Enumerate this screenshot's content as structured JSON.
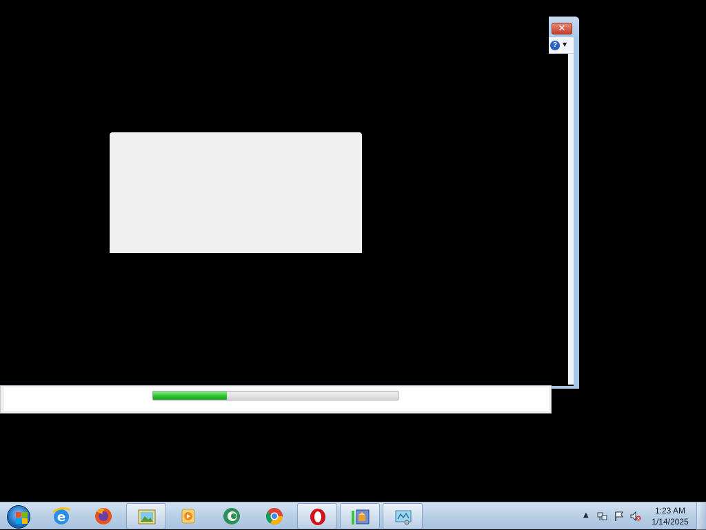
{
  "desktop": {
    "back_window": {
      "close_glyph": "✕",
      "help_glyph": "?",
      "help_dropdown_glyph": "▼"
    },
    "progress": {
      "fraction": 0.3
    }
  },
  "taskbar": {
    "start_icon": "windows-start-orb",
    "buttons": [
      {
        "name": "internet-explorer-icon",
        "active": false
      },
      {
        "name": "firefox-icon",
        "active": false
      },
      {
        "name": "photo-app-icon",
        "active": true
      },
      {
        "name": "media-player-icon",
        "active": false
      },
      {
        "name": "green-swirl-app-icon",
        "active": false
      },
      {
        "name": "chrome-icon",
        "active": false
      },
      {
        "name": "opera-icon",
        "active": true
      },
      {
        "name": "installer-app-icon",
        "active": true
      },
      {
        "name": "network-app-icon",
        "active": true
      }
    ],
    "tray": {
      "show_hidden_glyph": "▲",
      "time": "1:23 AM",
      "date": "1/14/2025"
    }
  }
}
